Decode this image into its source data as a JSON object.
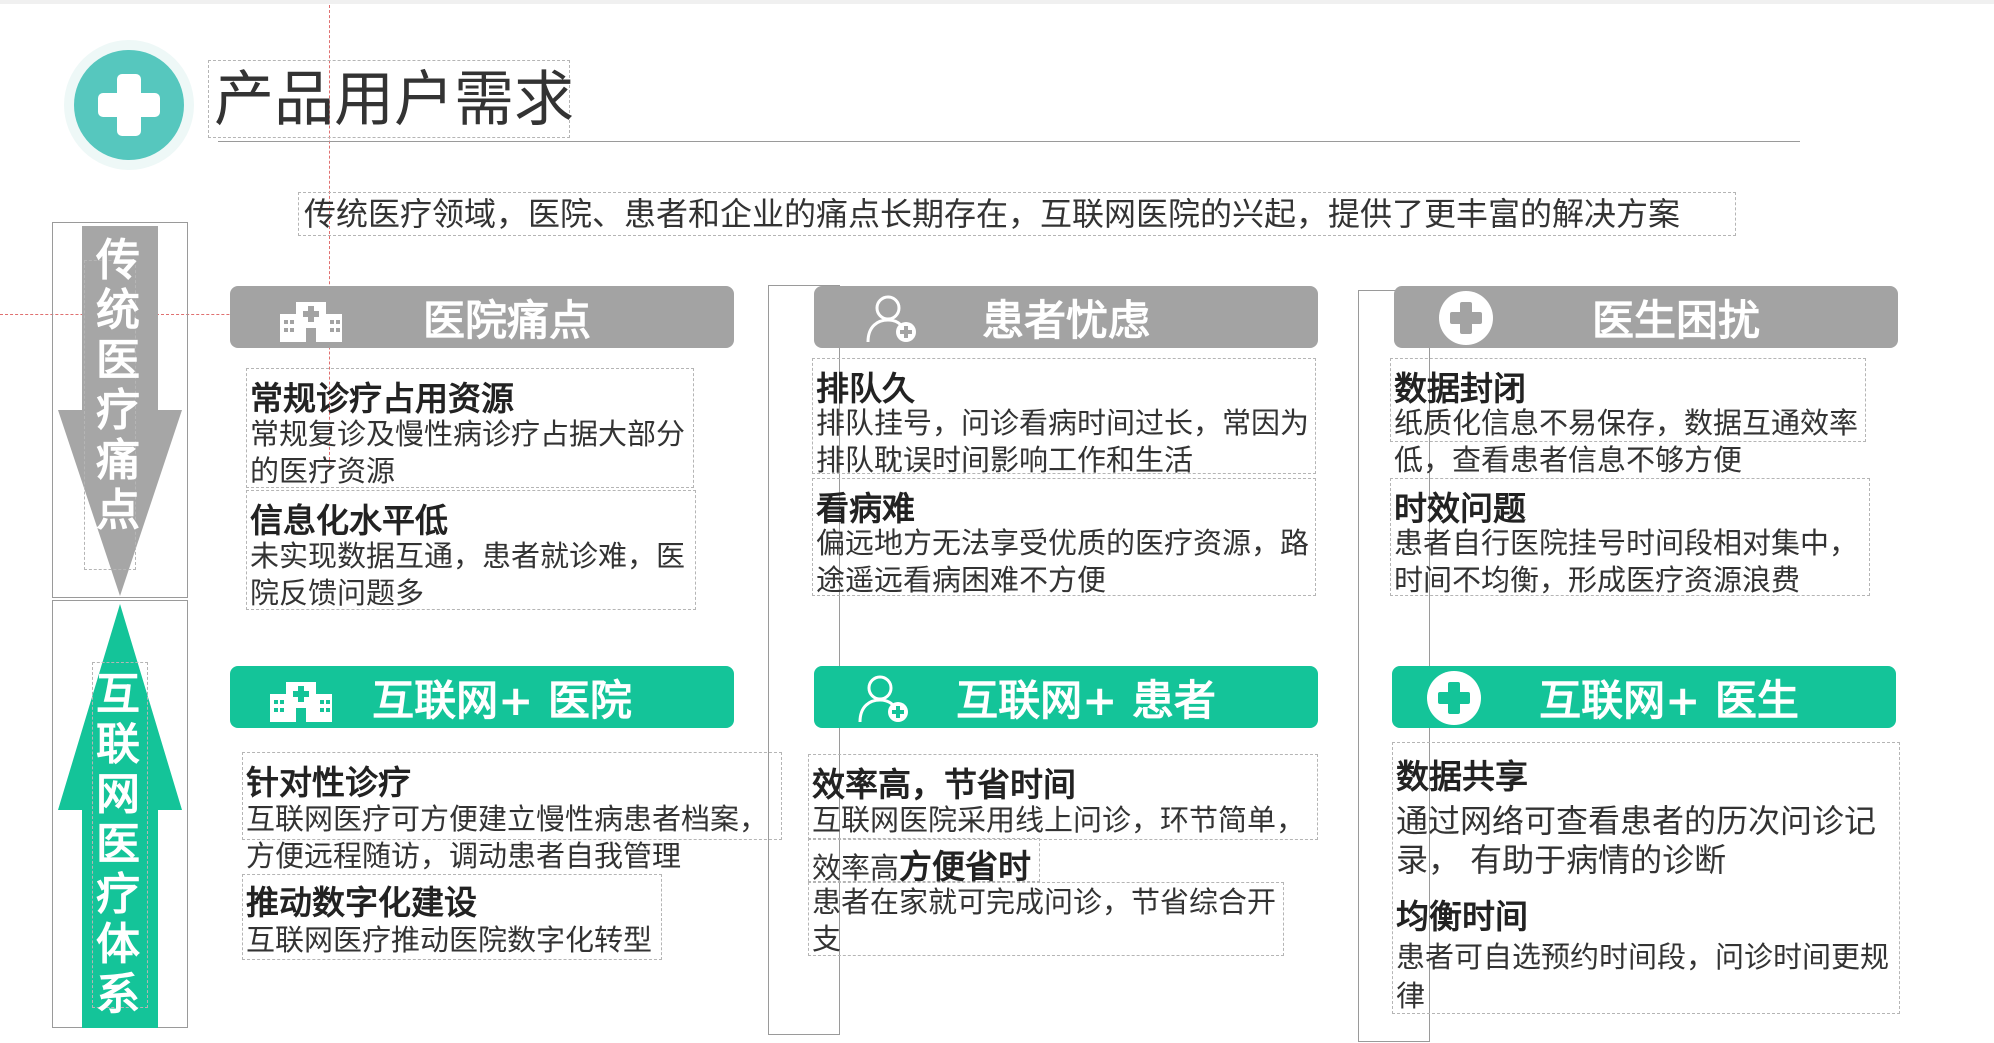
{
  "header": {
    "title": "产品用户需求"
  },
  "subtitle": "传统医疗领域，医院、患者和企业的痛点长期存在，互联网医院的兴起，提供了更丰富的解决方案",
  "side": {
    "top_label": "传统医疗痛点",
    "bottom_label": "互联网医疗体系"
  },
  "columns": [
    {
      "pain_title": "医院痛点",
      "pain_items": [
        {
          "title": "常规诊疗占用资源",
          "text": "常规复诊及慢性病诊疗占据大部分的医疗资源"
        },
        {
          "title": "信息化水平低",
          "text": "未实现数据互通，患者就诊难，医院反馈问题多"
        }
      ],
      "solution_title": "互联网+ 医院",
      "solution_items": [
        {
          "title": "针对性诊疗",
          "text": "互联网医疗可方便建立慢性病患者档案，方便远程随访，调动患者自我管理"
        },
        {
          "title": "推动数字化建设",
          "text": "互联网医疗推动医院数字化转型"
        }
      ]
    },
    {
      "pain_title": "患者忧虑",
      "pain_items": [
        {
          "title": "排队久",
          "text": "排队挂号，问诊看病时间过长，常因为排队耽误时间影响工作和生活"
        },
        {
          "title": "看病难",
          "text": "偏远地方无法享受优质的医疗资源，路途遥远看病困难不方便"
        }
      ],
      "solution_title": "互联网+ 患者",
      "solution_items": [
        {
          "title": "效率高，节省时间",
          "text_line1": "互联网医院采用线上问诊，环节简单，",
          "text_line2_prefix": "效率高",
          "text_line2_bold": "方便省时"
        },
        {
          "text": "患者在家就可完成问诊，节省综合开支"
        }
      ]
    },
    {
      "pain_title": "医生困扰",
      "pain_items": [
        {
          "title": "数据封闭",
          "text": "纸质化信息不易保存，数据互通效率低，查看患者信息不够方便"
        },
        {
          "title": "时效问题",
          "text": "患者自行医院挂号时间段相对集中，时间不均衡，形成医疗资源浪费"
        }
      ],
      "solution_title": "互联网+ 医生",
      "solution_items": [
        {
          "title": "数据共享",
          "text": "通过网络可查看患者的历次问诊记录，  有助于病情的诊断"
        },
        {
          "title": "均衡时间",
          "text": "患者可自选预约时间段，问诊时间更规律"
        }
      ]
    }
  ],
  "colors": {
    "teal": "#14c499",
    "gray_header": "#a3a3a3",
    "logo": "#56c7be",
    "arrow_gray": "#a6a6a6"
  },
  "icons": {
    "logo": "medical-cross-icon",
    "hospital": "hospital-icon",
    "patient": "patient-icon",
    "doctor": "medical-cross-icon"
  }
}
